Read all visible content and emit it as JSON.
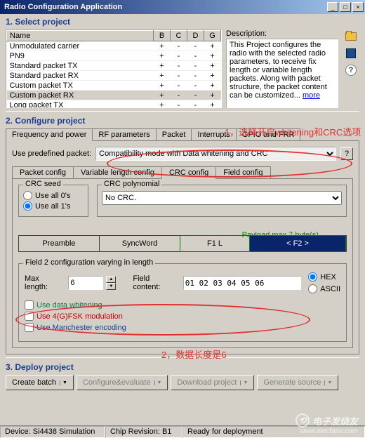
{
  "window": {
    "title": "Radio Configuration Application"
  },
  "sections": {
    "s1": "1. Select project",
    "s2": "2. Configure project",
    "s3": "3. Deploy project"
  },
  "project_table": {
    "headers": {
      "name": "Name",
      "b": "B",
      "c": "C",
      "d": "D",
      "g": "G"
    },
    "rows": [
      {
        "name": "Unmodulated carrier",
        "b": "+",
        "c": "-",
        "d": "-",
        "g": "+"
      },
      {
        "name": "PN9",
        "b": "+",
        "c": "-",
        "d": "-",
        "g": "+"
      },
      {
        "name": "Standard packet TX",
        "b": "+",
        "c": "-",
        "d": "-",
        "g": "+"
      },
      {
        "name": "Standard packet RX",
        "b": "+",
        "c": "-",
        "d": "-",
        "g": "+"
      },
      {
        "name": "Custom packet TX",
        "b": "+",
        "c": "-",
        "d": "-",
        "g": "+"
      },
      {
        "name": "Custom packet RX",
        "b": "+",
        "c": "-",
        "d": "-",
        "g": "+"
      },
      {
        "name": "Long packet TX",
        "b": "+",
        "c": "-",
        "d": "-",
        "g": "+"
      }
    ]
  },
  "description": {
    "label": "Description:",
    "text": "This Project configures the radio with the selected radio parameters, to receive fix length or variable length packets. Along with packet structure, the packet content can be customized... ",
    "more": "more"
  },
  "main_tabs": {
    "t1": "Frequency and power",
    "t2": "RF parameters",
    "t3": "Packet",
    "t4": "Interrupts",
    "t5": "GPIO and FRR"
  },
  "packet": {
    "predef_label": "Use predefined packet:",
    "predef_value": "Compatibility mode with Data whitening and CRC",
    "q": "?"
  },
  "sub_tabs": {
    "t1": "Packet config",
    "t2": "Variable length config",
    "t3": "CRC config",
    "t4": "Field config"
  },
  "crc": {
    "seed_legend": "CRC seed",
    "opt0": "Use all 0's",
    "opt1": "Use all 1's",
    "poly_legend": "CRC polynomial",
    "poly_value": "No CRC."
  },
  "payload": {
    "label": "Payload max 7 byte(s)",
    "preamble": "Preamble",
    "sync": "SyncWord",
    "f1l": "F1 L",
    "f2": "< F2 >"
  },
  "field2": {
    "legend": "Field 2 configuration varying in length",
    "maxlen_label": "Max length:",
    "maxlen_value": "6",
    "content_label": "Field content:",
    "content_value": "01 02 03 04 05 06",
    "hex": "HEX",
    "ascii": "ASCII"
  },
  "checks": {
    "whitening": "Use data whitening",
    "fsk": "Use 4(G)FSK modulation",
    "manchester": "Use Manchester encoding"
  },
  "deploy": {
    "batch": "Create batch",
    "config": "Configure&evaluate",
    "download": "Download project",
    "source": "Generate source"
  },
  "status": {
    "device": "Device: Si4438  Simulation",
    "chip": "Chip Revision: B1",
    "ready": "Ready for deployment"
  },
  "annotations": {
    "a1": "1，选择开启whitening和CRC选项",
    "a2": "2，数据长度是6"
  },
  "watermark": {
    "line1": "电子发烧友",
    "line2": "www.elecfans.com"
  }
}
